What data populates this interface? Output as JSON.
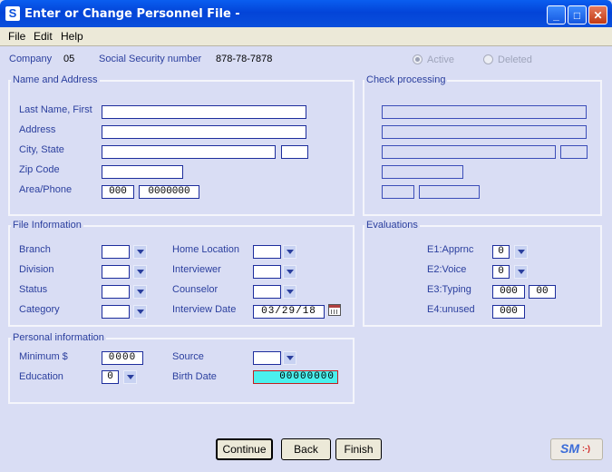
{
  "window": {
    "title": "Enter or Change Personnel File -",
    "icon_letter": "S",
    "controls": {
      "minimize": "_",
      "maximize": "□",
      "close": "✕"
    }
  },
  "menu": [
    "File",
    "Edit",
    "Help"
  ],
  "header": {
    "company_label": "Company",
    "company_value": "05",
    "ssn_label": "Social Security number",
    "ssn_value": "878-78-7878",
    "radio_active": "Active",
    "radio_deleted": "Deleted",
    "active_selected": true
  },
  "name_address": {
    "title": "Name and Address",
    "last_first_label": "Last Name, First",
    "address_label": "Address",
    "city_state_label": "City, State",
    "zip_label": "Zip Code",
    "area_phone_label": "Area/Phone",
    "area_value": "000",
    "phone_value": "0000000"
  },
  "check_processing": {
    "title": "Check processing"
  },
  "file_info": {
    "title": "File Information",
    "branch_label": "Branch",
    "division_label": "Division",
    "status_label": "Status",
    "category_label": "Category",
    "home_location_label": "Home Location",
    "interviewer_label": "Interviewer",
    "counselor_label": "Counselor",
    "interview_date_label": "Interview Date",
    "interview_date_value": "03/29/18"
  },
  "evaluations": {
    "title": "Evaluations",
    "e1_label": "E1:Apprnc",
    "e1_value": "0",
    "e2_label": "E2:Voice",
    "e2_value": "0",
    "e3_label": "E3:Typing",
    "e3_value_a": "000",
    "e3_value_b": "00",
    "e4_label": "E4:unused",
    "e4_value": "000"
  },
  "personal": {
    "title": "Personal information",
    "minimum_label": "Minimum $",
    "minimum_value": "0000",
    "education_label": "Education",
    "education_value": "0",
    "source_label": "Source",
    "birth_date_label": "Birth Date",
    "birth_date_value": "00000000"
  },
  "buttons": {
    "continue": "Continue",
    "back": "Back",
    "finish": "Finish",
    "logo_text": "SM",
    "logo_smiley": ":-)"
  },
  "colors": {
    "background": "#d9ddf4",
    "label": "#2b3f9e",
    "input_border": "#1d2d9c",
    "birth_date_fill": "#4af0ee",
    "birth_date_border": "#c02020",
    "titlebar": "#0a4fdc"
  }
}
